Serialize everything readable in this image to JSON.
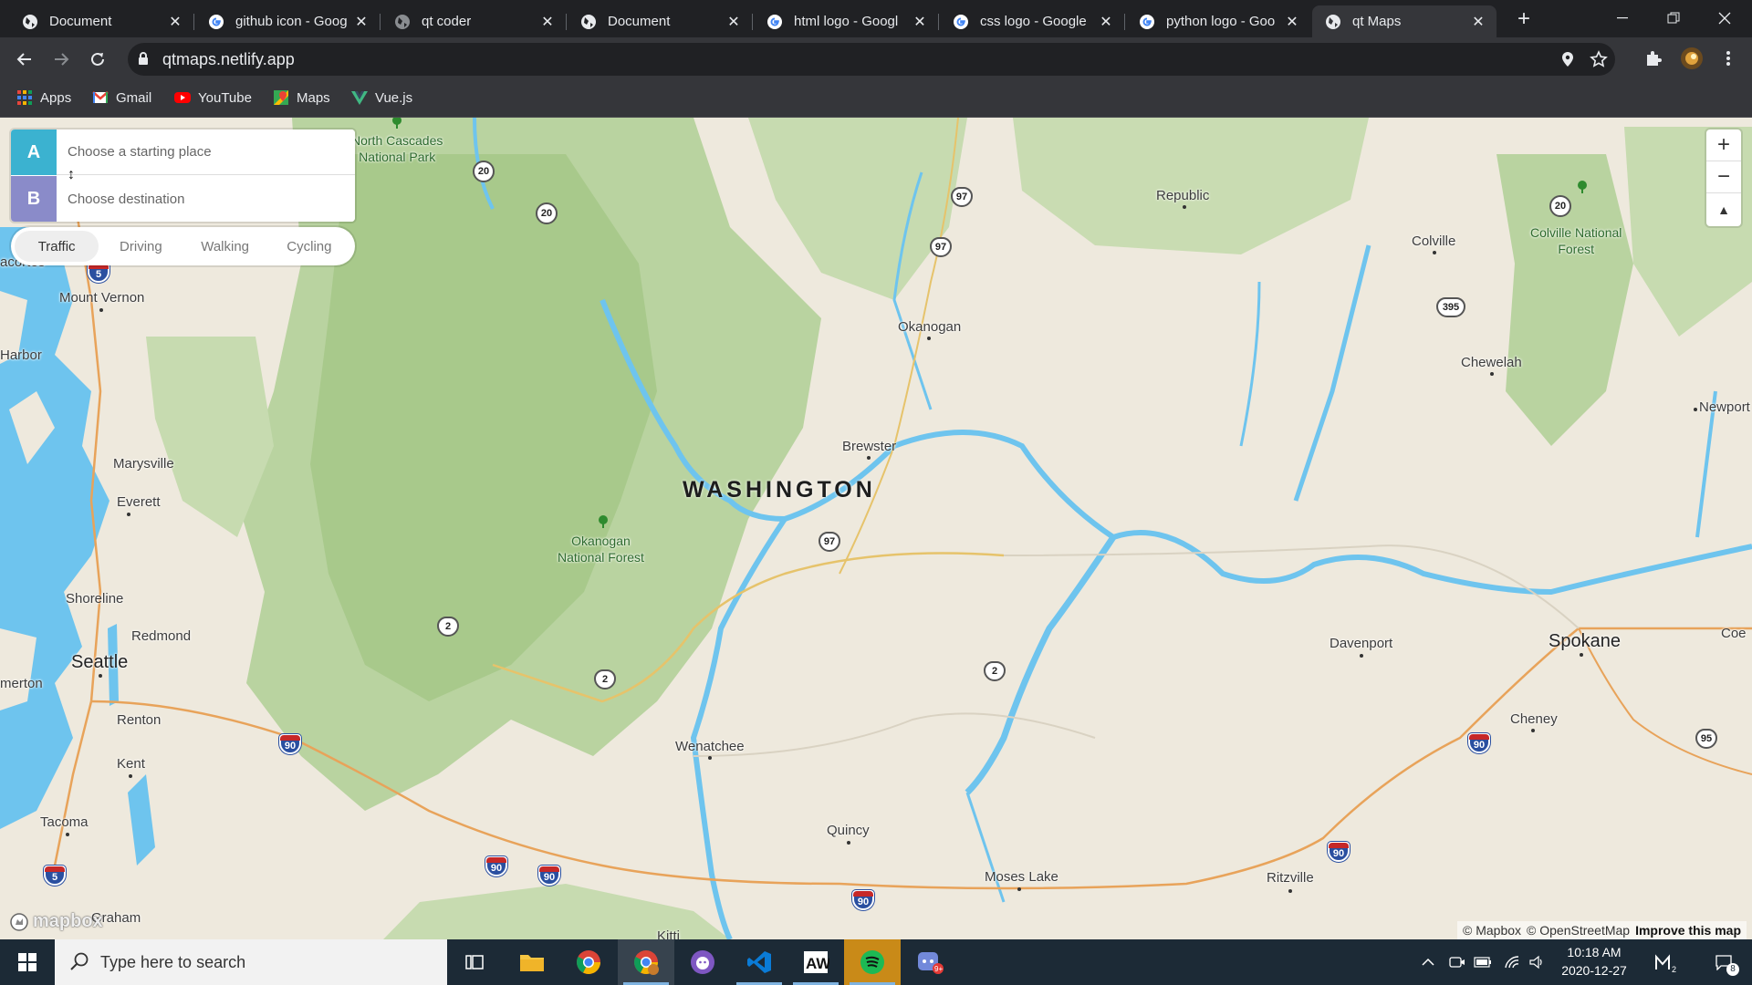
{
  "browser": {
    "tabs": [
      {
        "title": "Document",
        "favicon": "globe-icon"
      },
      {
        "title": "github icon - Goog",
        "favicon": "google-icon"
      },
      {
        "title": "qt coder",
        "favicon": "globe-icon"
      },
      {
        "title": "Document",
        "favicon": "globe-icon"
      },
      {
        "title": "html logo - Googl",
        "favicon": "google-icon"
      },
      {
        "title": "css logo - Google",
        "favicon": "google-icon"
      },
      {
        "title": "python logo - Goo",
        "favicon": "google-icon"
      },
      {
        "title": "qt Maps",
        "favicon": "globe-icon",
        "active": true
      }
    ],
    "url": "qtmaps.netlify.app",
    "bookmarks": [
      {
        "label": "Apps",
        "icon": "apps-grid-icon"
      },
      {
        "label": "Gmail",
        "icon": "gmail-icon"
      },
      {
        "label": "YouTube",
        "icon": "youtube-icon"
      },
      {
        "label": "Maps",
        "icon": "maps-icon"
      },
      {
        "label": "Vue.js",
        "icon": "vue-icon"
      }
    ]
  },
  "directions": {
    "a_label": "A",
    "b_label": "B",
    "origin_placeholder": "Choose a starting place",
    "destination_placeholder": "Choose destination",
    "profiles": [
      "Traffic",
      "Driving",
      "Walking",
      "Cycling"
    ],
    "active_profile": "Traffic"
  },
  "map": {
    "state_label": "WASHINGTON",
    "places": {
      "north_cascades_1": "North Cascades",
      "north_cascades_2": "National Park",
      "republic": "Republic",
      "colville": "Colville",
      "colville_nf_1": "Colville National",
      "colville_nf_2": "Forest",
      "anacortes": "acortes",
      "mount_vernon": "Mount Vernon",
      "okanogan": "Okanogan",
      "harbor": "Harbor",
      "chewelah": "Chewelah",
      "newport": "Newport",
      "marysville": "Marysville",
      "brewster": "Brewster",
      "everett": "Everett",
      "okanogan_nf_1": "Okanogan",
      "okanogan_nf_2": "National Forest",
      "shoreline": "Shoreline",
      "redmond": "Redmond",
      "seattle": "Seattle",
      "davenport": "Davenport",
      "spokane": "Spokane",
      "coeur": "Coe",
      "merton": "merton",
      "renton": "Renton",
      "cheney": "Cheney",
      "wenatchee": "Wenatchee",
      "kent": "Kent",
      "tacoma": "Tacoma",
      "quincy": "Quincy",
      "moses_lake": "Moses Lake",
      "ritzville": "Ritzville",
      "graham": "Graham",
      "kittitas": "Kitti"
    },
    "shields": {
      "us_20": "20",
      "us_97": "97",
      "us_2": "2",
      "us_395": "395",
      "i_5": "5",
      "i_90": "90",
      "us_95": "95"
    },
    "zoom_in": "+",
    "zoom_out": "−",
    "compass": "▲",
    "attribution": [
      "© Mapbox",
      "© OpenStreetMap",
      "Improve this map"
    ],
    "logo": "mapbox"
  },
  "taskbar": {
    "search_placeholder": "Type here to search",
    "time": "10:18 AM",
    "date": "2020-12-27",
    "notification_count": "8",
    "app_badge": "9+",
    "mail_badge": "2"
  },
  "colors": {
    "water": "#6ec4ee",
    "forest": "#b9d3a0",
    "land": "#eee9dd",
    "dir_a": "#3bb2d0",
    "dir_b": "#8a8bc9",
    "taskbar": "#1c2a36"
  }
}
